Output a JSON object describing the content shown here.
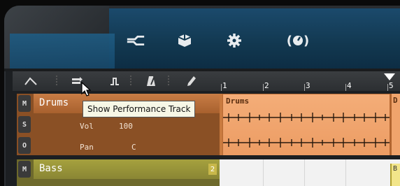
{
  "header": {
    "icons": [
      {
        "name": "routing-icon"
      },
      {
        "name": "cube-icon"
      },
      {
        "name": "gear-icon"
      },
      {
        "name": "performance-knob-icon",
        "paren_left": "(",
        "paren_right": ")"
      }
    ]
  },
  "toolbar": {
    "tools": [
      {
        "name": "automation-curve-tool-icon"
      },
      {
        "name": "performance-track-tool-icon"
      },
      {
        "name": "step-tool-icon"
      },
      {
        "name": "metronome-tool-icon"
      },
      {
        "name": "pencil-tool-icon"
      }
    ],
    "tooltip": "Show Performance Track"
  },
  "ruler": {
    "bars": [
      "1",
      "2",
      "3",
      "4",
      "5"
    ]
  },
  "tracks": [
    {
      "name": "Drums",
      "buttons": [
        "M",
        "S",
        "O"
      ],
      "params": [
        {
          "label": "Vol",
          "value": "100"
        },
        {
          "label": "Pan",
          "value": "C"
        }
      ],
      "clip_label": "Drums",
      "next_clip_label": "D",
      "color": "#c87d45"
    },
    {
      "name": "Bass",
      "buttons": [
        "M"
      ],
      "badge": "2",
      "next_clip_label": "B",
      "color": "#a6a13e"
    }
  ]
}
